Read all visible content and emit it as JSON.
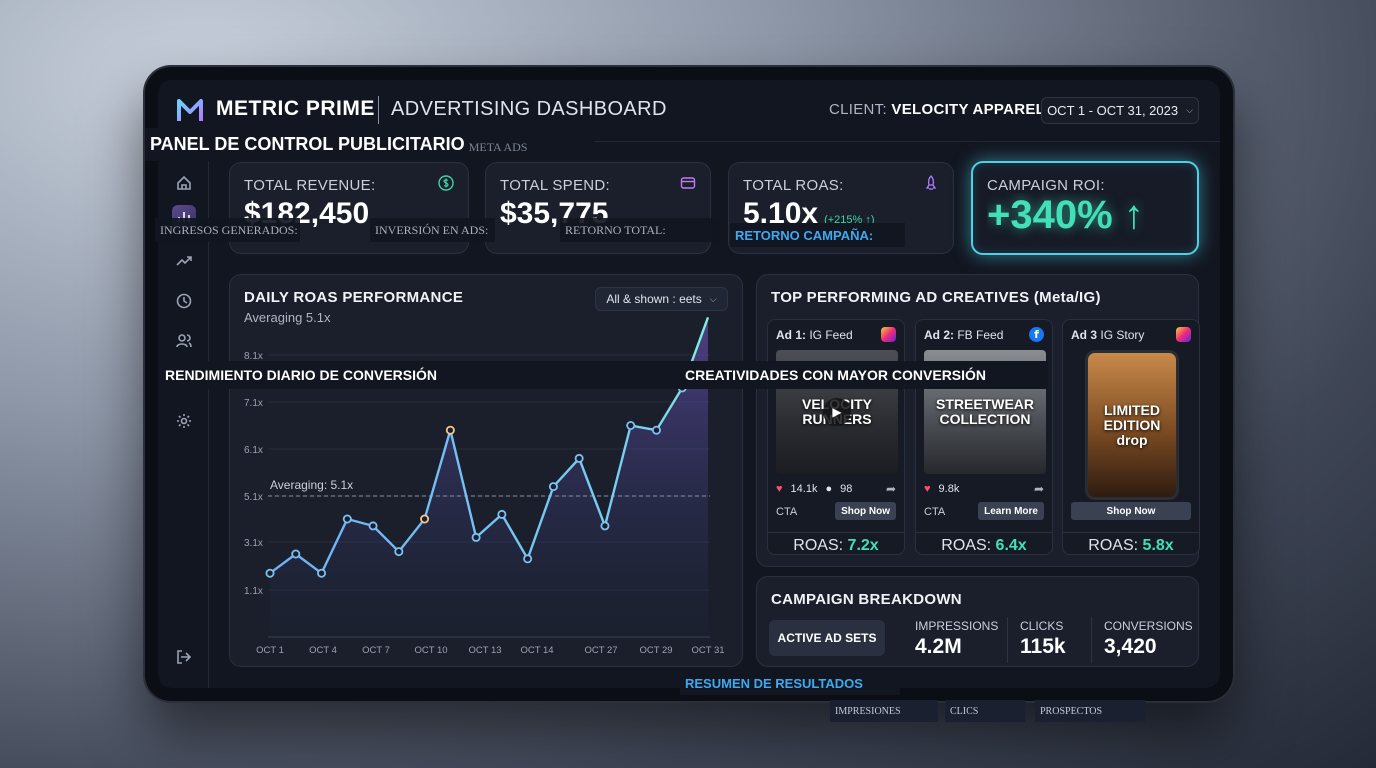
{
  "header": {
    "brand": "METRIC PRIME",
    "title": "ADVERTISING DASHBOARD",
    "client_label": "CLIENT:",
    "client_name": "VELOCITY APPAREL",
    "date_range": "OCT 1 - OCT 31, 2023"
  },
  "overlays": {
    "title_es": "PANEL DE CONTROL PUBLICITARIO",
    "meta_ads": "META ADS",
    "revenue_es": "INGRESOS GENERADOS:",
    "spend_es": "INVERSIÓN EN ADS:",
    "roas_es": "RETORNO TOTAL:",
    "roi_es": "RETORNO CAMPAÑA:",
    "chart_es": "RENDIMIENTO DIARIO DE CONVERSIÓN",
    "creatives_es": "CREATIVIDADES CON MAYOR CONVERSIÓN",
    "breakdown_es": "RESUMEN DE RESULTADOS",
    "impressions_es": "IMPRESIONES",
    "clicks_es": "CLICS",
    "conversions_es": "PROSPECTOS"
  },
  "kpis": {
    "revenue": {
      "label": "TOTAL REVENUE:",
      "value": "$182,450"
    },
    "spend": {
      "label": "TOTAL SPEND:",
      "value": "$35,775"
    },
    "roas": {
      "label": "TOTAL ROAS:",
      "value": "5.10x",
      "delta": "(+215% ↑)"
    },
    "roi": {
      "label": "CAMPAIGN ROI:",
      "value": "+340% ↑"
    }
  },
  "roas_chart": {
    "title": "DAILY ROAS PERFORMANCE",
    "subtitle": "Averaging 5.1x",
    "filter": "All & shown : eets",
    "avg_label": "Averaging: 5.1x"
  },
  "chart_data": {
    "type": "line",
    "title": "DAILY ROAS PERFORMANCE",
    "y_ticks": [
      "1.1x",
      "3.1x",
      "5.1x",
      "6.1x",
      "7.1x",
      "8.1x"
    ],
    "x_ticks": [
      "OCT 1",
      "OCT 4",
      "OCT 7",
      "OCT 10",
      "OCT 13",
      "OCT 14",
      "OCT 27",
      "OCT 29",
      "OCT 31"
    ],
    "average": 5.1,
    "series": [
      {
        "values": [
          1.8,
          2.6,
          1.8,
          4.1,
          3.8,
          2.7,
          4.1,
          6.5,
          3.3,
          4.3,
          2.4,
          5.3,
          5.9,
          3.8,
          6.6,
          6.5,
          7.4,
          8.9
        ]
      }
    ]
  },
  "creatives": {
    "title": "TOP PERFORMING AD CREATIVES (Meta/IG)",
    "ads": [
      {
        "num": "Ad 1:",
        "placement": "IG Feed",
        "image_text": "VELOCITY RUNNERS",
        "likes": "14.1k",
        "comments": "98",
        "cta": "CTA",
        "button": "Shop Now",
        "roas_label": "ROAS:",
        "roas": "7.2x"
      },
      {
        "num": "Ad 2:",
        "placement": "FB Feed",
        "image_text": "STREETWEAR COLLECTION",
        "likes": "9.8k",
        "cta": "CTA",
        "button": "Learn More",
        "roas_label": "ROAS:",
        "roas": "6.4x"
      },
      {
        "num": "Ad 3",
        "placement": "IG Story",
        "image_text": "LIMITED EDITION drop",
        "button": "Shop Now",
        "roas_label": "ROAS:",
        "roas": "5.8x"
      }
    ]
  },
  "breakdown": {
    "title": "CAMPAIGN BREAKDOWN",
    "active_button": "ACTIVE AD SETS",
    "impressions_label": "IMPRESSIONS",
    "impressions": "4.2M",
    "clicks_label": "CLICKS",
    "clicks": "115k",
    "conversions_label": "CONVERSIONS",
    "conversions": "3,420"
  },
  "colors": {
    "accent": "#42e0b8",
    "roi_border": "#4fd0e6",
    "line": "#6fb8f0",
    "highlight": "#f2c98a"
  }
}
